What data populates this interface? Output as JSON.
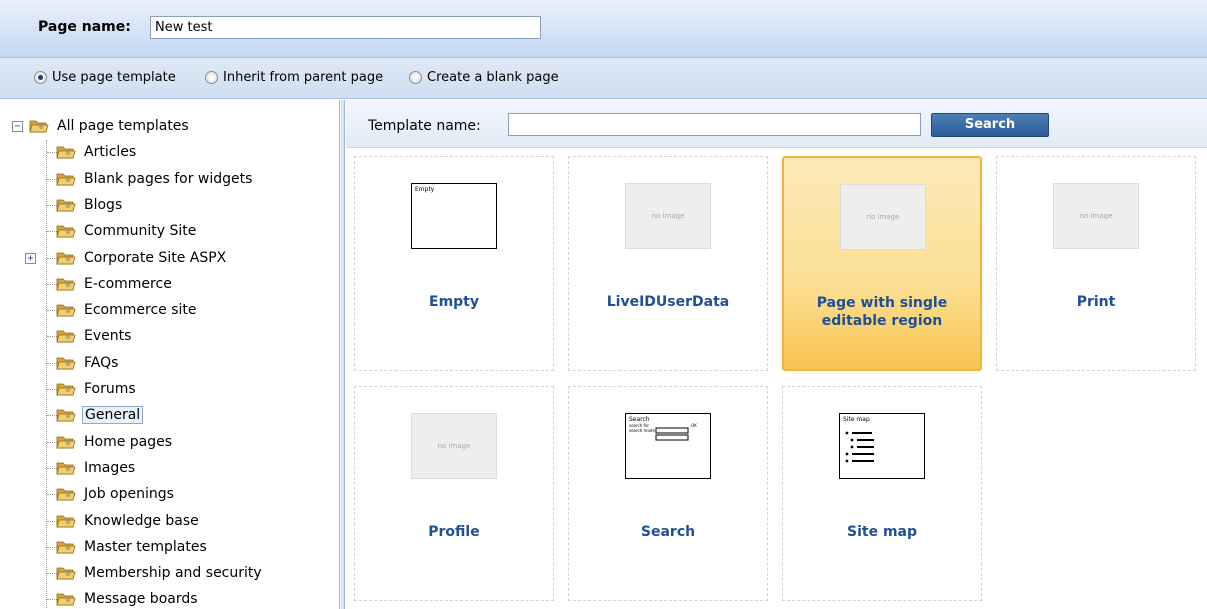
{
  "header": {
    "page_name_label": "Page name:",
    "page_name_value": "New test"
  },
  "options": {
    "items": [
      {
        "label": "Use page template",
        "checked": true
      },
      {
        "label": "Inherit from parent page",
        "checked": false
      },
      {
        "label": "Create a blank page",
        "checked": false
      }
    ]
  },
  "tree": {
    "root": "All page templates",
    "items": [
      {
        "label": "Articles"
      },
      {
        "label": "Blank pages for widgets"
      },
      {
        "label": "Blogs"
      },
      {
        "label": "Community Site"
      },
      {
        "label": "Corporate Site ASPX",
        "expandable": true
      },
      {
        "label": "E-commerce"
      },
      {
        "label": "Ecommerce site"
      },
      {
        "label": "Events"
      },
      {
        "label": "FAQs"
      },
      {
        "label": "Forums"
      },
      {
        "label": "General",
        "selected": true
      },
      {
        "label": "Home pages"
      },
      {
        "label": "Images"
      },
      {
        "label": "Job openings"
      },
      {
        "label": "Knowledge base"
      },
      {
        "label": "Master templates"
      },
      {
        "label": "Membership and security"
      },
      {
        "label": "Message boards"
      }
    ]
  },
  "search": {
    "label": "Template name:",
    "value": "",
    "button": "Search"
  },
  "templates": [
    {
      "title": "Empty",
      "thumb_text": "Empty",
      "thumb_type": "empty"
    },
    {
      "title": "LiveIDUserData",
      "thumb_text": "no image",
      "thumb_type": "none"
    },
    {
      "title": "Page with single editable region",
      "thumb_text": "no image",
      "thumb_type": "none",
      "selected": true
    },
    {
      "title": "Print",
      "thumb_text": "no image",
      "thumb_type": "none"
    },
    {
      "title": "Profile",
      "thumb_text": "no image",
      "thumb_type": "none"
    },
    {
      "title": "Search",
      "thumb_text": "Search",
      "thumb_type": "search"
    },
    {
      "title": "Site map",
      "thumb_text": "Site map",
      "thumb_type": "sitemap"
    }
  ],
  "thumb_labels": {
    "search_for": "search for",
    "search_mode": "search mode",
    "go": "OK"
  },
  "colors": {
    "link": "#1f4f96",
    "selected_card": "#fcdf93",
    "button": "#2b5c97"
  }
}
